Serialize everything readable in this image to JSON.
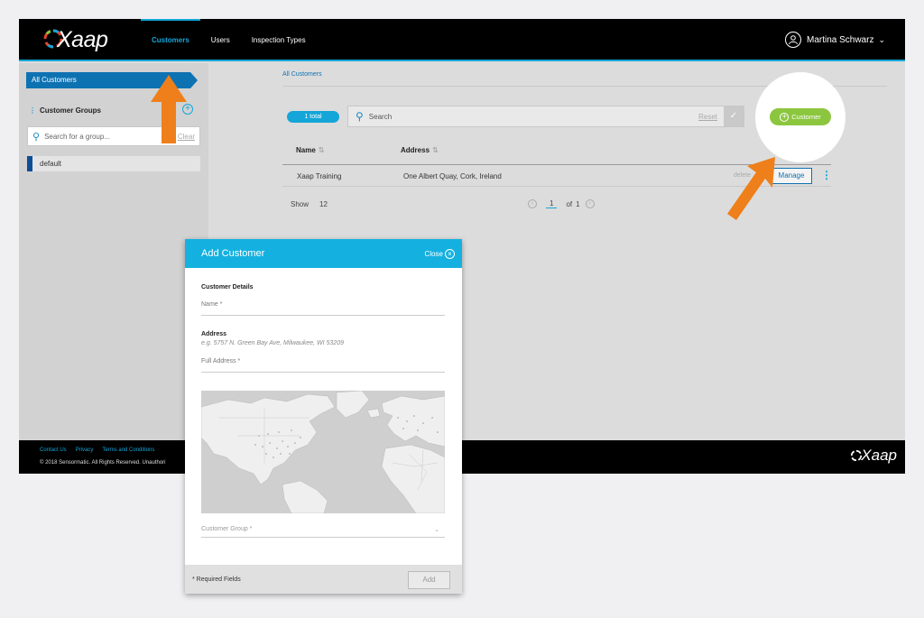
{
  "header": {
    "logo": "Xaap",
    "nav": [
      "Customers",
      "Users",
      "Inspection Types"
    ],
    "user_name": "Martina Schwarz"
  },
  "sidebar": {
    "all_customers": "All Customers",
    "groups_title": "Customer Groups",
    "group_search_placeholder": "Search for a group...",
    "group_search_clear": "Clear",
    "groups": [
      "default"
    ]
  },
  "main": {
    "breadcrumb": "All Customers",
    "total": "1 total",
    "search_placeholder": "Search",
    "reset": "Reset",
    "add_customer": "Customer",
    "columns": [
      "Name",
      "Address"
    ],
    "rows": [
      {
        "name": "Xaap Training",
        "address": "One Albert Quay, Cork, Ireland",
        "delete": "delete",
        "manage": "Manage"
      }
    ],
    "show_label": "Show",
    "show_value": "12",
    "page_current": "1",
    "page_of": "of",
    "page_total": "1"
  },
  "footer": {
    "links": [
      "Contact Us",
      "Privacy",
      "Terms and Conditions"
    ],
    "copyright": "© 2018 Sensormatic. All Rights Reserved. Unauthori",
    "logo": "Xaap"
  },
  "modal": {
    "title": "Add Customer",
    "close": "Close",
    "section_details": "Customer Details",
    "name_label": "Name *",
    "section_address": "Address",
    "address_hint": "e.g. 5757 N. Green Bay Ave, Milwaukee, WI 53209",
    "full_address_label": "Full Address *",
    "group_label": "Customer Group *",
    "required_note": "* Required Fields",
    "add": "Add"
  },
  "colors": {
    "accent": "#14a6d8",
    "primary": "#0d72b2",
    "success": "#8cc63f",
    "annotation": "#ee7f1a"
  }
}
